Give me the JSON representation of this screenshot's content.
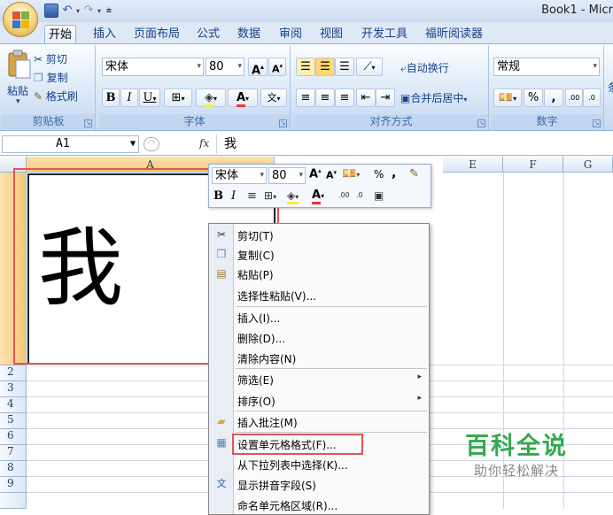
{
  "window": {
    "title": "Book1 - Micr"
  },
  "tabs": [
    "开始",
    "插入",
    "页面布局",
    "公式",
    "数据",
    "审阅",
    "视图",
    "开发工具",
    "福昕阅读器"
  ],
  "clipboard": {
    "paste": "粘贴",
    "cut": "剪切",
    "copy": "复制",
    "format_painter": "格式刷",
    "label": "剪贴板"
  },
  "font": {
    "name": "宋体",
    "size": "80",
    "grow": "A",
    "shrink": "A",
    "bold": "B",
    "italic": "I",
    "underline": "U",
    "color_letter": "A",
    "label": "字体"
  },
  "alignment": {
    "wrap": "自动换行",
    "merge": "合并后居中",
    "label": "对齐方式"
  },
  "number": {
    "format": "常规",
    "percent": "%",
    "comma": ",",
    "label": "数字"
  },
  "formula_bar": {
    "name_box": "A1",
    "fx": "fx",
    "content": "我"
  },
  "columns": [
    "A",
    "E",
    "F",
    "G"
  ],
  "rows": [
    "2",
    "3",
    "4",
    "5",
    "6",
    "7",
    "8",
    "9"
  ],
  "cell_a1": "我",
  "mini_toolbar": {
    "font": "宋体",
    "size": "80",
    "percent": "%",
    "comma": ",",
    "bold": "B",
    "italic": "I",
    "color_letter": "A"
  },
  "context_menu": {
    "items": [
      "剪切(T)",
      "复制(C)",
      "粘贴(P)",
      "选择性粘贴(V)...",
      "插入(I)...",
      "删除(D)...",
      "清除内容(N)",
      "筛选(E)",
      "排序(O)",
      "插入批注(M)",
      "设置单元格格式(F)...",
      "从下拉列表中选择(K)...",
      "显示拼音字段(S)",
      "命名单元格区域(R)..."
    ]
  },
  "watermark": {
    "title": "百科全说",
    "subtitle": "助你轻松解决"
  },
  "colors": {
    "highlight": "#e53935",
    "accent": "#15428b"
  }
}
